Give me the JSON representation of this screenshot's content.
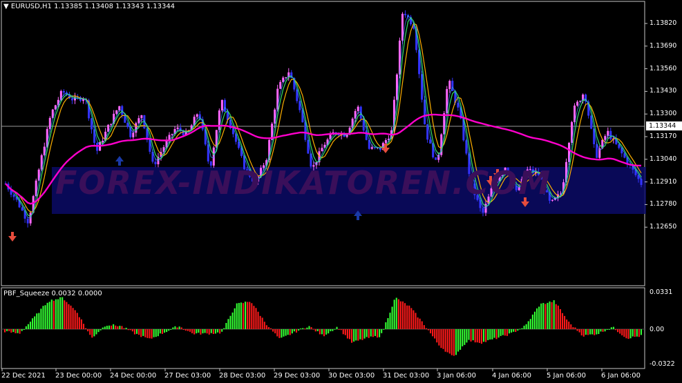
{
  "main_panel": {
    "title_arrow": "▼",
    "symbol": "EURUSD,H1",
    "ohlc": "1.13385 1.13408 1.13343 1.13344",
    "current_price": "1.13344",
    "price_labels": [
      "1.13820",
      "1.13690",
      "1.13560",
      "1.13430",
      "1.13300",
      "1.13170",
      "1.13040",
      "1.12910",
      "1.12780",
      "1.12650"
    ],
    "watermark": "FOREX-INDIKATOREN.COM",
    "colors": {
      "background": "#000000",
      "bull_bar": "#ff66ff",
      "bear_bar": "#3333ff",
      "ma_line": "#ff00cc",
      "sell_arrow": "#e74c3c",
      "buy_arrow": "#1a3aa8",
      "watermark_band": "#0a0a66"
    }
  },
  "sub_panel": {
    "indicator": "PBF_Squeeze 0.0032 0.0000",
    "labels": [
      "0.0331",
      "0.00",
      "-0.0322"
    ],
    "colors": {
      "positive": "#33ff33",
      "negative": "#ff1a1a"
    }
  },
  "time_axis": [
    "22 Dec 2021",
    "23 Dec 00:00",
    "24 Dec 00:00",
    "27 Dec 03:00",
    "28 Dec 03:00",
    "29 Dec 03:00",
    "30 Dec 03:00",
    "31 Dec 03:00",
    "3 Jan 06:00",
    "4 Jan 06:00",
    "5 Jan 06:00",
    "6 Jan 06:00"
  ],
  "chart_data": {
    "type": "candlestick",
    "series": [
      {
        "name": "EURUSD,H1",
        "close": [
          1.129,
          1.128,
          1.1268,
          1.13,
          1.133,
          1.1343,
          1.1338,
          1.134,
          1.1308,
          1.1322,
          1.1335,
          1.1318,
          1.133,
          1.13,
          1.1312,
          1.1322,
          1.1318,
          1.1332,
          1.1298,
          1.1338,
          1.132,
          1.13,
          1.129,
          1.1305,
          1.1345,
          1.1355,
          1.133,
          1.1298,
          1.1312,
          1.132,
          1.1318,
          1.1335,
          1.131,
          1.131,
          1.132,
          1.139,
          1.138,
          1.132,
          1.13,
          1.135,
          1.133,
          1.129,
          1.1272,
          1.129,
          1.13,
          1.1285,
          1.1298,
          1.1295,
          1.1278,
          1.1285,
          1.1332,
          1.1343,
          1.1305,
          1.132,
          1.131,
          1.13,
          1.129
        ]
      },
      {
        "name": "PBF_Squeeze",
        "values": [
          -0.002,
          -0.004,
          0.01,
          0.025,
          0.028,
          0.015,
          -0.008,
          0.004,
          0.003,
          -0.004,
          -0.009,
          -0.003,
          0.003,
          -0.004,
          -0.004,
          -0.003,
          0.022,
          0.025,
          0.006,
          -0.009,
          -0.003,
          0.003,
          -0.006,
          0.002,
          -0.012,
          -0.008,
          -0.006,
          0.028,
          0.02,
          0.004,
          -0.014,
          -0.025,
          -0.01,
          -0.012,
          -0.008,
          -0.004,
          0.003,
          0.022,
          0.025,
          0.006,
          -0.006,
          -0.004,
          0.002,
          -0.008,
          -0.006
        ]
      }
    ]
  }
}
